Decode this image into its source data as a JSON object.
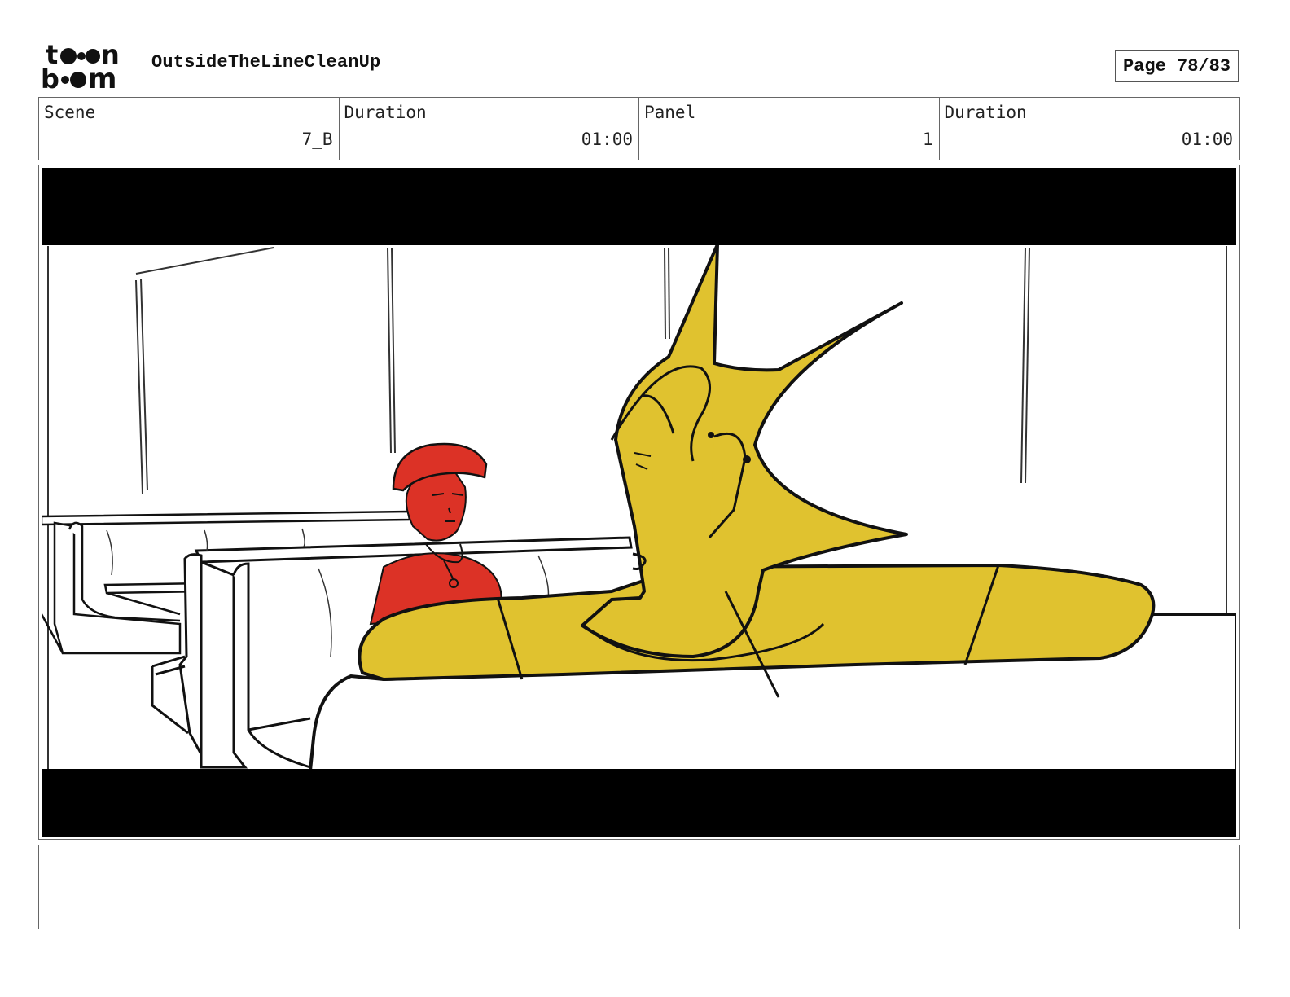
{
  "header": {
    "logo_text_top": "toon",
    "logo_text_bottom": "boom",
    "project_title": "OutsideTheLineCleanUp",
    "page_indicator": "Page 78/83"
  },
  "info": [
    {
      "label": "Scene",
      "value": "7_B"
    },
    {
      "label": "Duration",
      "value": "01:00"
    },
    {
      "label": "Panel",
      "value": "1"
    },
    {
      "label": "Duration",
      "value": "01:00"
    }
  ],
  "panel": {
    "image_subject": "diner-booth-sketch",
    "colors": {
      "letterbox": "#000000",
      "yellow_character": "#e0c22f",
      "red_character": "#dc3226",
      "line": "#111111"
    }
  },
  "caption": {
    "text": ""
  }
}
